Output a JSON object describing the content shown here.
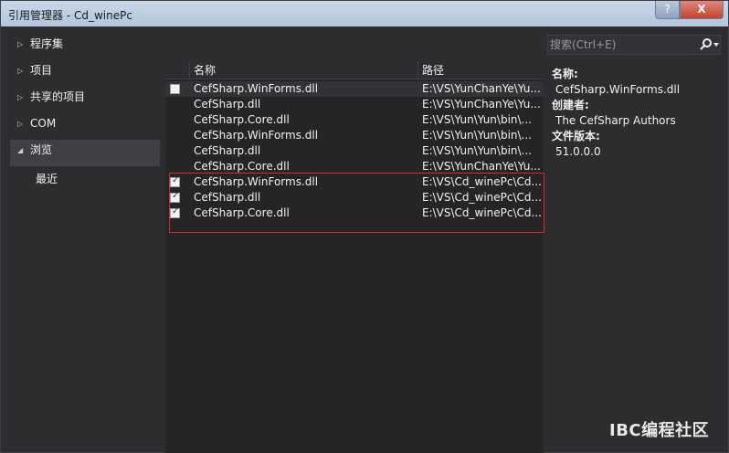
{
  "window": {
    "title": "引用管理器 - Cd_winePc",
    "help_label": "?",
    "close_label": "X"
  },
  "nav": {
    "items": [
      {
        "label": "程序集",
        "expanded": false
      },
      {
        "label": "项目",
        "expanded": false
      },
      {
        "label": "共享的项目",
        "expanded": false
      },
      {
        "label": "COM",
        "expanded": false
      },
      {
        "label": "浏览",
        "expanded": true,
        "selected": true
      }
    ],
    "sub_items": [
      {
        "label": "最近"
      }
    ]
  },
  "list": {
    "columns": {
      "name": "名称",
      "path": "路径"
    },
    "rows": [
      {
        "checkbox": true,
        "checked": false,
        "name": "CefSharp.WinForms.dll",
        "path": "E:\\VS\\YunChanYe\\Yu..."
      },
      {
        "checkbox": false,
        "checked": false,
        "name": "CefSharp.dll",
        "path": "E:\\VS\\YunChanYe\\Yu..."
      },
      {
        "checkbox": false,
        "checked": false,
        "name": "CefSharp.Core.dll",
        "path": "E:\\VS\\Yun\\Yun\\bin\\..."
      },
      {
        "checkbox": false,
        "checked": false,
        "name": "CefSharp.WinForms.dll",
        "path": "E:\\VS\\Yun\\Yun\\bin\\..."
      },
      {
        "checkbox": false,
        "checked": false,
        "name": "CefSharp.dll",
        "path": "E:\\VS\\Yun\\Yun\\bin\\..."
      },
      {
        "checkbox": false,
        "checked": false,
        "name": "CefSharp.Core.dll",
        "path": "E:\\VS\\YunChanYe\\Yu..."
      },
      {
        "checkbox": true,
        "checked": true,
        "name": "CefSharp.WinForms.dll",
        "path": "E:\\VS\\Cd_winePc\\Cd..."
      },
      {
        "checkbox": true,
        "checked": true,
        "name": "CefSharp.dll",
        "path": "E:\\VS\\Cd_winePc\\Cd..."
      },
      {
        "checkbox": true,
        "checked": true,
        "name": "CefSharp.Core.dll",
        "path": "E:\\VS\\Cd_winePc\\Cd..."
      }
    ]
  },
  "search": {
    "placeholder": "搜索(Ctrl+E)",
    "icon": "search-icon"
  },
  "details": {
    "name_label": "名称:",
    "name_value": "CefSharp.WinForms.dll",
    "creator_label": "创建者:",
    "creator_value": "The CefSharp Authors",
    "version_label": "文件版本:",
    "version_value": "51.0.0.0"
  },
  "watermark": "IBC编程社区",
  "colors": {
    "background": "#2d2d30",
    "list_background": "#252526",
    "highlight_row": "#333337",
    "selection_border": "#d72b2b",
    "close_button": "#c3432e"
  }
}
